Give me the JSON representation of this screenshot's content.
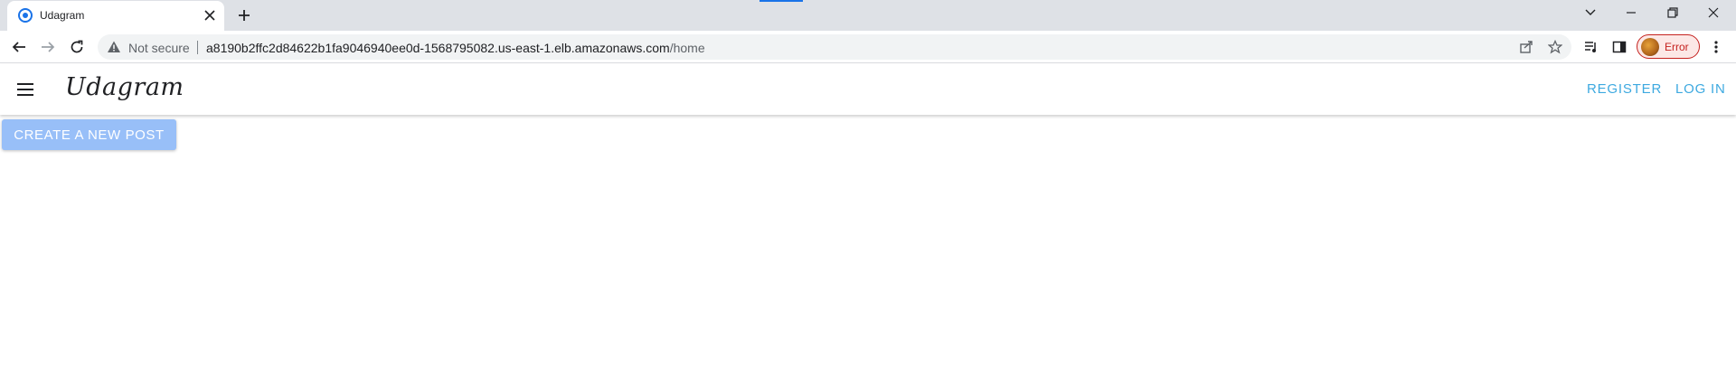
{
  "browser": {
    "tab": {
      "title": "Udagram",
      "favicon": "chromium-loading-icon"
    },
    "new_tab_icon": "plus-icon",
    "window_controls": [
      "tab-search-icon",
      "minimize-icon",
      "restore-icon",
      "close-icon"
    ],
    "security_label": "Not secure",
    "url_host": "a8190b2ffc2d84622b1fa9046940ee0d-1568795082.us-east-1.elb.amazonaws.com",
    "url_path": "/home",
    "profile_label": "Error",
    "accent": "#1a73e8",
    "error_color": "#c5221f"
  },
  "app": {
    "brand": "Udagram",
    "nav": {
      "register": "REGISTER",
      "login": "LOG IN"
    },
    "create_button": "CREATE A NEW POST",
    "colors": {
      "link": "#3da9e0",
      "primary_disabled": "#98bff8"
    }
  }
}
